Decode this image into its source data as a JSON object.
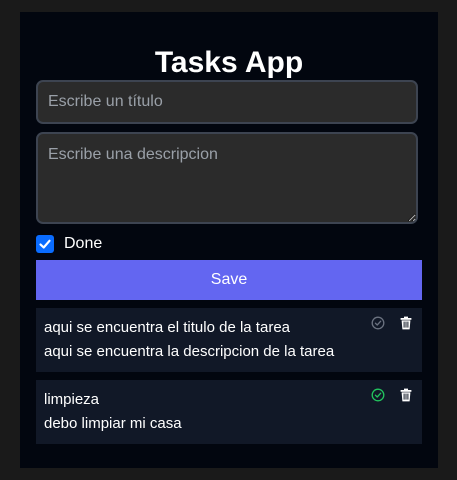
{
  "app": {
    "title": "Tasks App"
  },
  "form": {
    "title_placeholder": "Escribe un título",
    "description_placeholder": "Escribe una descripcion",
    "done_label": "Done",
    "done_checked": true,
    "save_label": "Save"
  },
  "tasks": [
    {
      "title": "aqui se encuentra el titulo de la tarea",
      "description": "aqui se encuentra la descripcion de la tarea",
      "done": false,
      "status_icon": "check-circle-icon",
      "status_color": "#6b7280"
    },
    {
      "title": "limpieza",
      "description": "debo limpiar mi casa",
      "done": true,
      "status_icon": "check-circle-icon",
      "status_color": "#22c55e"
    }
  ],
  "colors": {
    "accent": "#6366f1",
    "checkbox": "#0a6cff",
    "card_background": "#02060f",
    "task_background": "#111827"
  }
}
